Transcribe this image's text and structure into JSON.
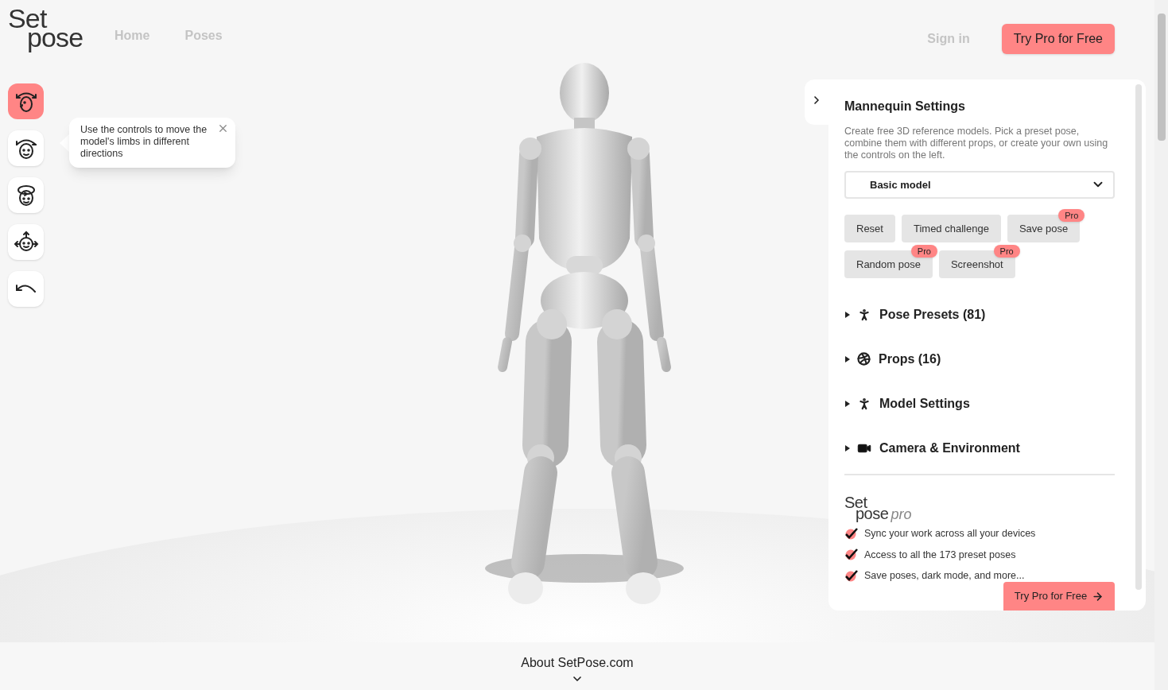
{
  "logo": {
    "line1": "Set",
    "line2": "pose"
  },
  "nav": [
    {
      "label": "Home"
    },
    {
      "label": "Poses"
    }
  ],
  "sign_in": "Sign in",
  "cta": "Try Pro for Free",
  "toolbar": [
    {
      "kind": "rotate-side",
      "selected": true
    },
    {
      "kind": "rotate-front",
      "selected": false
    },
    {
      "kind": "rotate-around",
      "selected": false
    },
    {
      "kind": "move",
      "selected": false
    },
    {
      "kind": "undo",
      "selected": false
    }
  ],
  "tooltip": {
    "text": "Use the controls to move the model's limbs in different directions"
  },
  "panel": {
    "title": "Mannequin Settings",
    "description": "Create free 3D reference models. Pick a preset pose, combine them with different props, or create your own using the controls on the left.",
    "model_select": {
      "value": "Basic model"
    },
    "actions": [
      {
        "label": "Reset"
      },
      {
        "label": "Timed challenge"
      },
      {
        "label": "Save pose",
        "badge": "Pro"
      },
      {
        "label": "Random pose",
        "badge": "Pro"
      },
      {
        "label": "Screenshot",
        "badge": "Pro"
      }
    ],
    "sections": [
      {
        "kind": "poses",
        "label": "Pose Presets (81)",
        "expanded": false
      },
      {
        "kind": "props",
        "label": "Props (16)",
        "expanded": false
      },
      {
        "kind": "model",
        "label": "Model Settings",
        "expanded": false
      },
      {
        "kind": "camera",
        "label": "Camera & Environment",
        "expanded": false
      }
    ],
    "pro": {
      "logo_line1": "Set",
      "logo_line2": "pose",
      "logo_suffix": "pro",
      "features": [
        {
          "text": "Sync your work across all your devices",
          "checked": true
        },
        {
          "text": "Access to all the 173 preset poses",
          "checked": true
        },
        {
          "text": "Save poses, dark mode, and more...",
          "checked": true
        }
      ],
      "cta": "Try Pro for Free"
    }
  },
  "footer": {
    "label": "About SetPose.com"
  }
}
